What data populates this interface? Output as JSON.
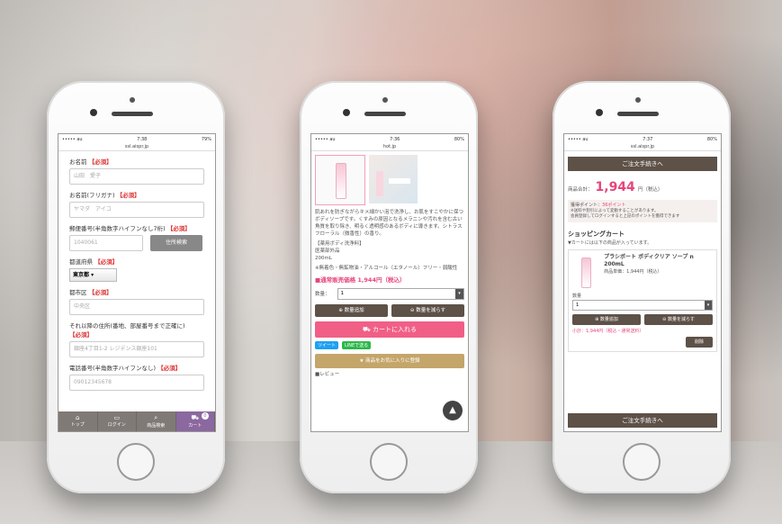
{
  "phone1": {
    "status": {
      "carrier": "••••• au",
      "time": "7:38",
      "battery": "79%"
    },
    "url": "ssl.aispr.jp",
    "required": "【必須】",
    "fields": [
      {
        "label": "お名前",
        "placeholder": "山田　愛子"
      },
      {
        "label": "お名前(フリガナ)",
        "placeholder": "ヤマダ　アイコ"
      },
      {
        "label": "郵便番号(半角数字ハイフンなし7桁)",
        "placeholder": "1040061"
      },
      {
        "label": "都道府県",
        "placeholder": ""
      },
      {
        "label": "都市区",
        "placeholder": "中央区"
      },
      {
        "label": "それ以降の住所(番地、部屋番号まで正確に)",
        "placeholder": "銀座4丁目1-2 レジデンス銀座101"
      },
      {
        "label": "電話番号(半角数字ハイフンなし)",
        "placeholder": "09012345678"
      }
    ],
    "zip_button": "住所検索",
    "prefecture_value": "東京都",
    "tabs": [
      {
        "icon": "⌂",
        "label": "トップ"
      },
      {
        "icon": "▭",
        "label": "ログイン"
      },
      {
        "icon": "⌕",
        "label": "商品検索"
      },
      {
        "icon": "⛟",
        "label": "カート"
      }
    ],
    "cart_badge": "0"
  },
  "phone2": {
    "status": {
      "carrier": "••••• au",
      "time": "7:36",
      "battery": "80%"
    },
    "url": "hot.jp",
    "description": "肌あれを防ぎながらキメ細かい泡で洗浄し、お肌をすこやかに保つボディソープです。くすみの原因となるメラニンや汚れを含む古い角質を取り除き、明るく透明感のあるボディに導きます。シトラスフローラル（微香性）の香り。",
    "spec_lines": [
      "【薬用ボディ洗浄料】",
      "医薬部外品",
      "200mL",
      "※無着色・無鉱物油・アルコール（エタノール）フリー・弱酸性"
    ],
    "price_label": "■通常販売価格 1,944円（税込）",
    "qty_label": "数量：",
    "qty_value": "1",
    "add_qty": "数量追加",
    "reduce_qty": "数量を減らす",
    "cart_button": "カートに入れる",
    "tweet": "ツイート",
    "line": "LINEで送る",
    "favorite": "商品をお気に入りに登録",
    "review": "■レビュー"
  },
  "phone3": {
    "status": {
      "carrier": "••••• au",
      "time": "7:37",
      "battery": "80%"
    },
    "url": "ssl.aispr.jp",
    "checkout_button": "ご注文手続きへ",
    "total_label": "商品合計：",
    "total_value": "1,944",
    "total_unit": "円（税込）",
    "points_label": "獲得ポイント：",
    "points_value": "36ポイント",
    "points_note1": "※送料や割引によって変動することがあります。",
    "points_note2": "会員登録してログインすると上記のポイントを獲得できます",
    "cart_title": "ショッピングカート",
    "cart_sub": "▼カートには以下の商品が入っています。",
    "item_name": "プラシボート ボディクリア ソープ n 200mL",
    "item_price": "商品単価：1,944円（税込）",
    "qty_label": "数量",
    "qty_value": "1",
    "add_qty": "数量追加",
    "reduce_qty": "数量を減らす",
    "subtotal": "小計：1,944円（税込・通常送料）",
    "delete_button": "削除"
  }
}
